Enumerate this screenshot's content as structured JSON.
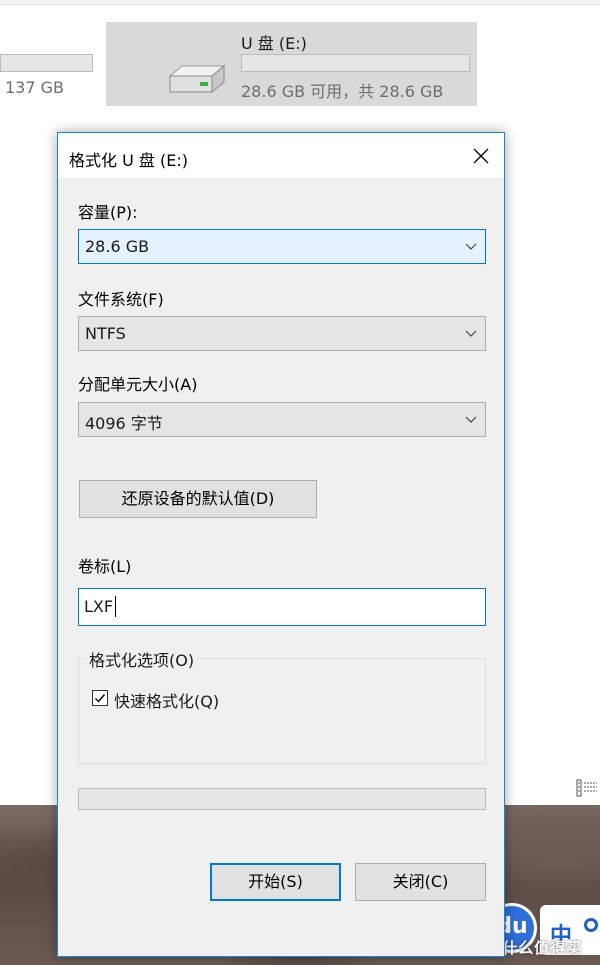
{
  "explorer": {
    "other_drive_size": "137 GB",
    "drive_tile": {
      "name": "U 盘 (E:)",
      "free_text": "28.6 GB 可用，共 28.6 GB",
      "used_fraction": 0.0
    }
  },
  "dialog": {
    "title": "格式化 U 盘 (E:)",
    "capacity": {
      "label": "容量(P):",
      "value": "28.6 GB"
    },
    "filesystem": {
      "label": "文件系统(F)",
      "value": "NTFS"
    },
    "allocation": {
      "label": "分配单元大小(A)",
      "value": "4096 字节"
    },
    "restore_defaults_label": "还原设备的默认值(D)",
    "volume_label": {
      "label": "卷标(L)",
      "value": "LXF"
    },
    "options": {
      "group_label": "格式化选项(O)",
      "quick_format_label": "快速格式化(Q)",
      "quick_format_checked": true
    },
    "progress": 0,
    "start_label": "开始(S)",
    "close_label": "关闭(C)"
  },
  "taskbar": {
    "du_badge": "du",
    "ime_char": "中",
    "watermark": "值 什么值得买"
  },
  "colors": {
    "accent": "#0078d7",
    "dialog_border": "#1883d7",
    "badge_blue": "#2f6fd9"
  },
  "icons": [
    "hard-drive-icon",
    "close-icon",
    "chevron-down-icon",
    "checkmark-icon",
    "view-toggle-icon"
  ]
}
